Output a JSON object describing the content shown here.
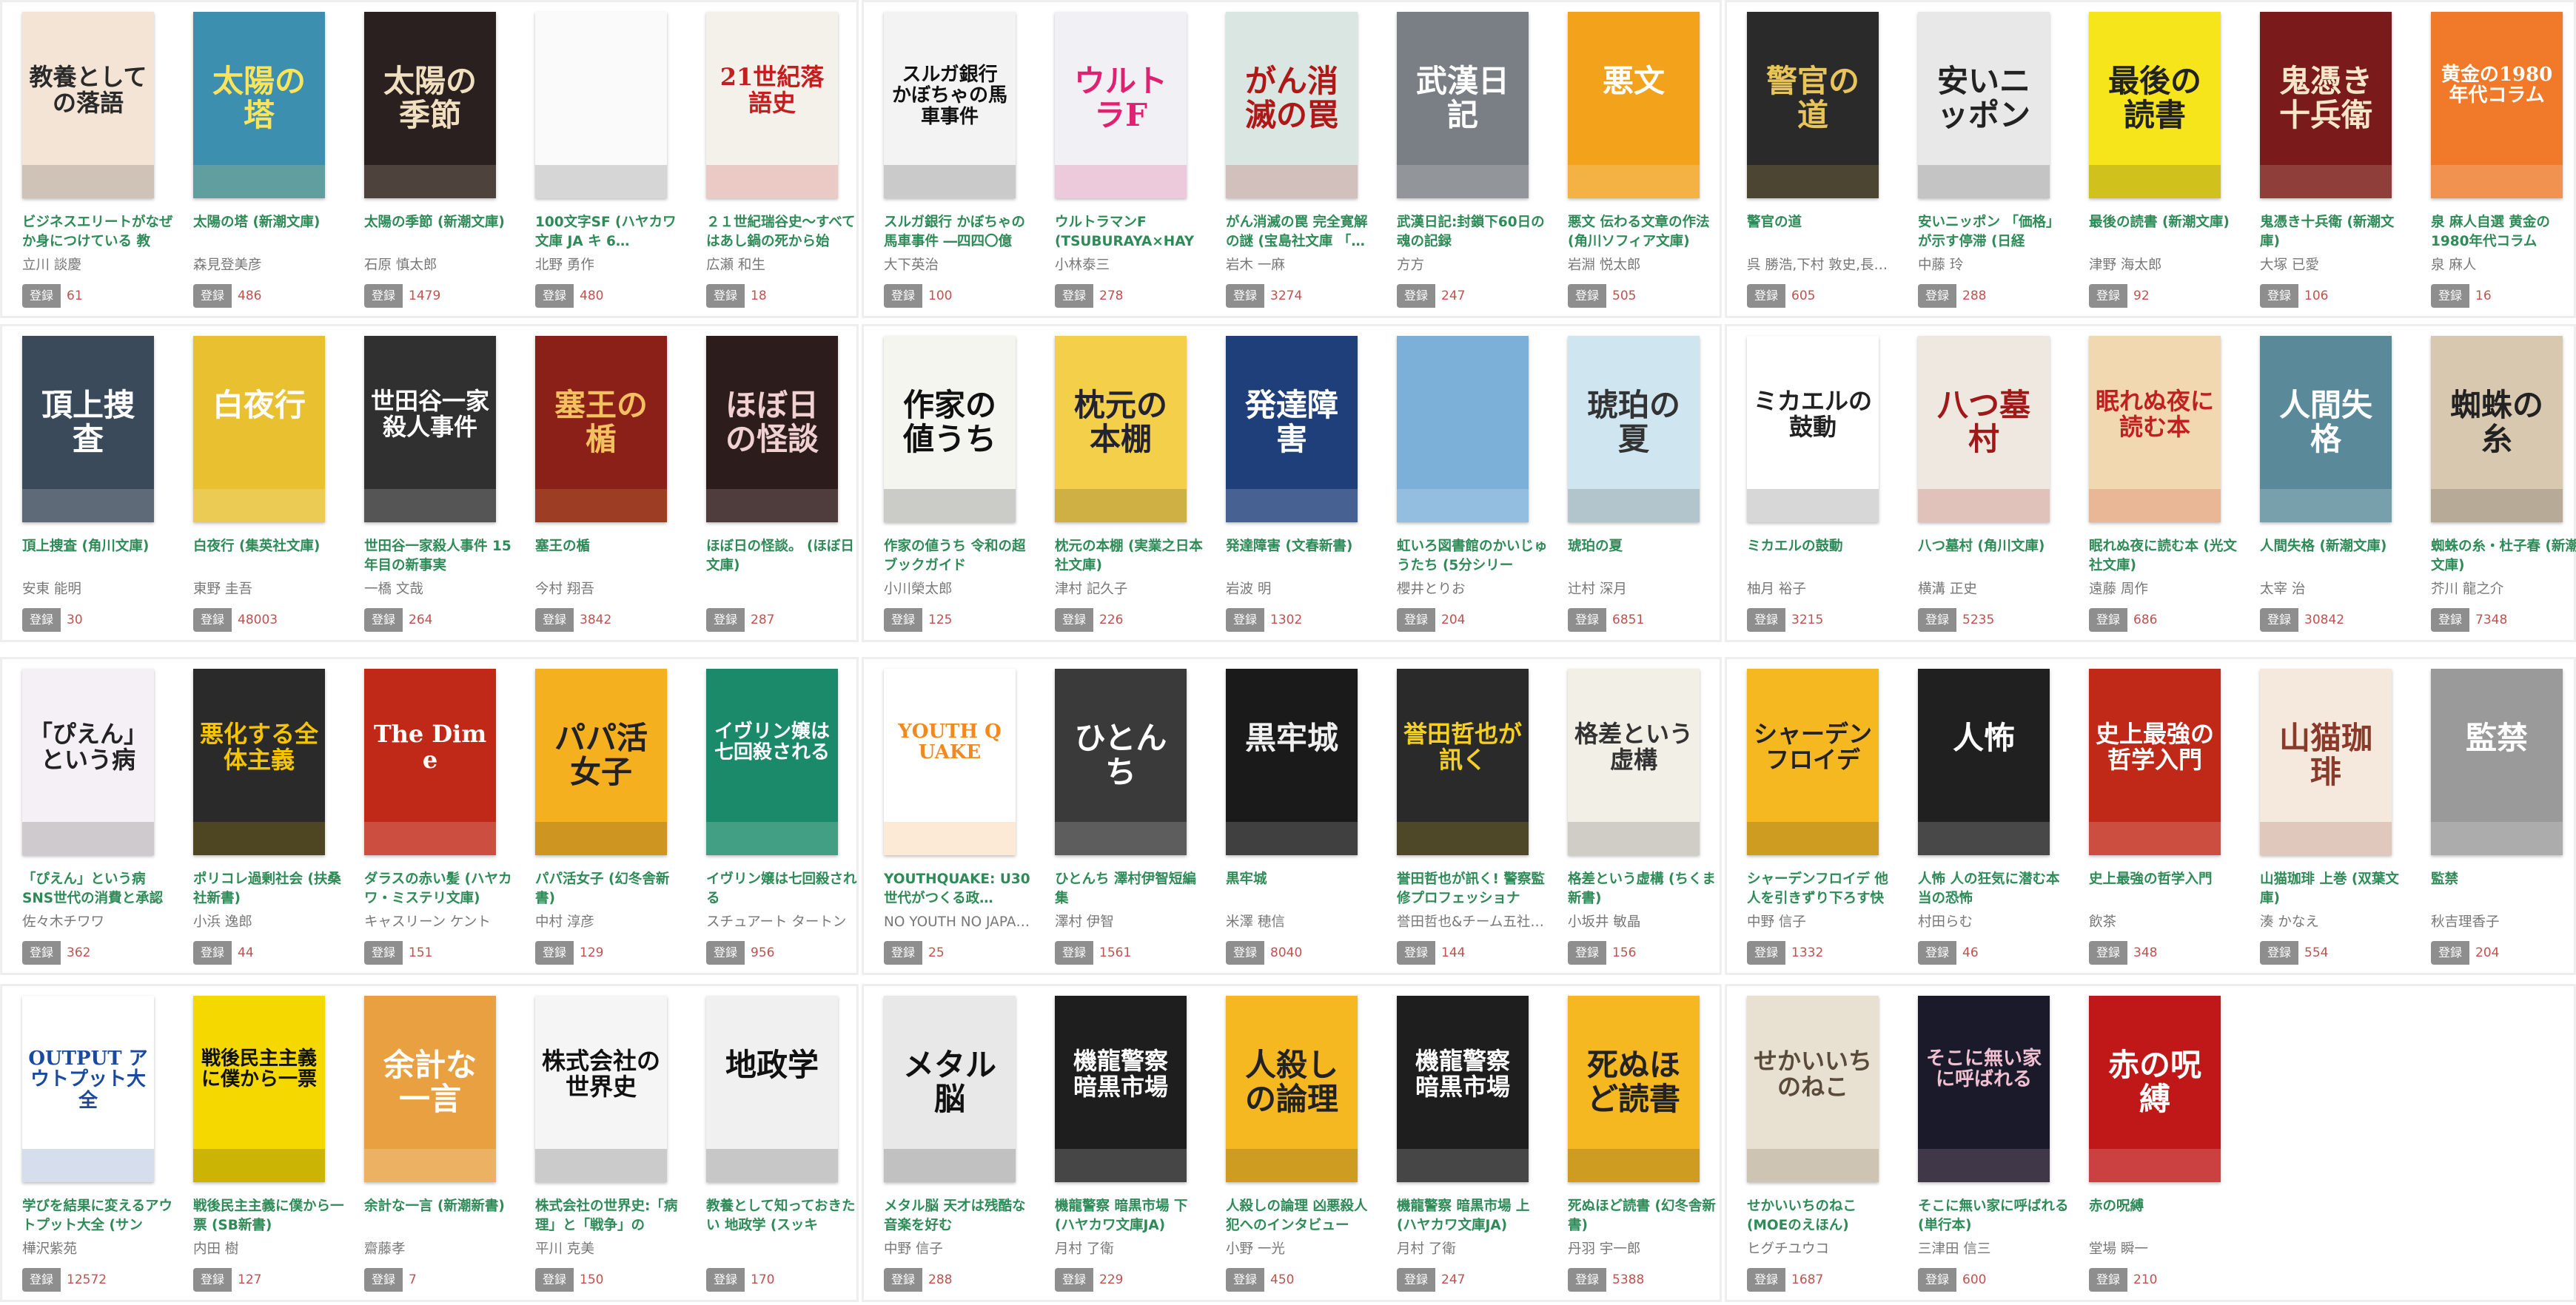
{
  "register_label": "登録",
  "books": [
    {
      "title": "ビジネスエリートがなぜか身につけている 教",
      "author": "立川 談慶",
      "count": "61",
      "cover_text": "教養としての落語",
      "bg": "#f3e4d6",
      "fg": "#2a2a2a"
    },
    {
      "title": "太陽の塔 (新潮文庫)",
      "author": "森見登美彦",
      "count": "486",
      "cover_text": "太陽の塔",
      "bg": "#3d8fb0",
      "fg": "#ffe45a"
    },
    {
      "title": "太陽の季節 (新潮文庫)",
      "author": "石原 慎太郎",
      "count": "1479",
      "cover_text": "太陽の季節",
      "bg": "#2b2020",
      "fg": "#f0e0c0"
    },
    {
      "title": "100文字SF (ハヤカワ文庫 JA キ 6…",
      "author": "北野 勇作",
      "count": "480",
      "cover_text": "",
      "bg": "#fafafa",
      "fg": "#333"
    },
    {
      "title": "２１世紀瑞谷史～すべてはあし鍋の死から始",
      "author": "広瀬 和生",
      "count": "18",
      "cover_text": "21世紀落語史",
      "bg": "#f4f0ea",
      "fg": "#c41e1e"
    },
    {
      "title": "スルガ銀行 かぼちゃの馬車事件 ―四四〇億",
      "author": "大下英治",
      "count": "100",
      "cover_text": "スルガ銀行 かぼちゃの馬車事件",
      "bg": "#f3f3f3",
      "fg": "#111"
    },
    {
      "title": "ウルトラマンF (TSUBURAYA×HAY",
      "author": "小林泰三",
      "count": "278",
      "cover_text": "ウルトラF",
      "bg": "#f0f0f5",
      "fg": "#e02070"
    },
    {
      "title": "がん消滅の罠 完全寛解の謎 (宝島社文庫 「…",
      "author": "岩木 一麻",
      "count": "3274",
      "cover_text": "がん消滅の罠",
      "bg": "#d9e6e1",
      "fg": "#b01818"
    },
    {
      "title": "武漢日記:封鎖下60日の魂の記録",
      "author": "方方",
      "count": "247",
      "cover_text": "武漢日記",
      "bg": "#7a7f86",
      "fg": "#ffffff"
    },
    {
      "title": "悪文 伝わる文章の作法 (角川ソフィア文庫)",
      "author": "岩淵 悦太郎",
      "count": "505",
      "cover_text": "悪文",
      "bg": "#f2a21b",
      "fg": "#ffffff"
    },
    {
      "title": "警官の道",
      "author": "呉 勝浩,下村 敦史,長…",
      "count": "605",
      "cover_text": "警官の道",
      "bg": "#2a2a2a",
      "fg": "#e8c45a"
    },
    {
      "title": "安いニッポン 「価格」が示す停滞 (日経",
      "author": "中藤 玲",
      "count": "288",
      "cover_text": "安いニッポン",
      "bg": "#e8e8e8",
      "fg": "#222"
    },
    {
      "title": "最後の読書 (新潮文庫)",
      "author": "津野 海太郎",
      "count": "92",
      "cover_text": "最後の読書",
      "bg": "#f7e51c",
      "fg": "#222"
    },
    {
      "title": "鬼憑き十兵衛 (新潮文庫)",
      "author": "大塚 已愛",
      "count": "106",
      "cover_text": "鬼憑き十兵衛",
      "bg": "#7a1a1a",
      "fg": "#f5e6c8"
    },
    {
      "title": "泉 麻人自選 黄金の1980年代コラム",
      "author": "泉 麻人",
      "count": "16",
      "cover_text": "黄金の1980年代コラム",
      "bg": "#f07a2a",
      "fg": "#ffffff"
    },
    {
      "title": "頂上捜査 (角川文庫)",
      "author": "安東 能明",
      "count": "30",
      "cover_text": "頂上捜査",
      "bg": "#3b4a5a",
      "fg": "#ffffff"
    },
    {
      "title": "白夜行 (集英社文庫)",
      "author": "東野 圭吾",
      "count": "48003",
      "cover_text": "白夜行",
      "bg": "#e8c030",
      "fg": "#ffffff"
    },
    {
      "title": "世田谷一家殺人事件 15年目の新事実",
      "author": "一橋 文哉",
      "count": "264",
      "cover_text": "世田谷一家殺人事件",
      "bg": "#303030",
      "fg": "#ffffff"
    },
    {
      "title": "塞王の楯",
      "author": "今村 翔吾",
      "count": "3842",
      "cover_text": "塞王の楯",
      "bg": "#8a2018",
      "fg": "#f2c060"
    },
    {
      "title": "ほぼ日の怪談。 (ほぼ日文庫)",
      "author": "",
      "count": "287",
      "cover_text": "ほぼ日の怪談",
      "bg": "#2c1c1c",
      "fg": "#f0d0d0"
    },
    {
      "title": "作家の値うち 令和の超ブックガイド",
      "author": "小川榮太郎",
      "count": "125",
      "cover_text": "作家の値うち",
      "bg": "#f5f5f0",
      "fg": "#111"
    },
    {
      "title": "枕元の本棚 (実業之日本社文庫)",
      "author": "津村 記久子",
      "count": "226",
      "cover_text": "枕元の本棚",
      "bg": "#f4d04a",
      "fg": "#223"
    },
    {
      "title": "発達障害 (文春新書)",
      "author": "岩波 明",
      "count": "1302",
      "cover_text": "発達障害",
      "bg": "#1e3f7a",
      "fg": "#ffffff"
    },
    {
      "title": "虹いろ図書館のかいじゅうたち (5分シリー",
      "author": "櫻井とりお",
      "count": "204",
      "cover_text": "",
      "bg": "#7cb0d8",
      "fg": "#fff"
    },
    {
      "title": "琥珀の夏",
      "author": "辻村 深月",
      "count": "6851",
      "cover_text": "琥珀の夏",
      "bg": "#cfe6f0",
      "fg": "#333"
    },
    {
      "title": "ミカエルの鼓動",
      "author": "柚月 裕子",
      "count": "3215",
      "cover_text": "ミカエルの鼓動",
      "bg": "#ffffff",
      "fg": "#222"
    },
    {
      "title": "八つ墓村 (角川文庫)",
      "author": "横溝 正史",
      "count": "5235",
      "cover_text": "八つ墓村",
      "bg": "#efe8e0",
      "fg": "#a01818"
    },
    {
      "title": "眠れぬ夜に読む本 (光文社文庫)",
      "author": "遠藤 周作",
      "count": "686",
      "cover_text": "眠れぬ夜に読む本",
      "bg": "#f2d8b0",
      "fg": "#c02020"
    },
    {
      "title": "人間失格 (新潮文庫)",
      "author": "太宰 治",
      "count": "30842",
      "cover_text": "人間失格",
      "bg": "#5a8a9a",
      "fg": "#ffffff"
    },
    {
      "title": "蜘蛛の糸・杜子春 (新潮文庫)",
      "author": "芥川 龍之介",
      "count": "7348",
      "cover_text": "蜘蛛の糸",
      "bg": "#d8c8b0",
      "fg": "#222"
    },
    {
      "title": "「ぴえん」という病 SNS世代の消費と承認",
      "author": "佐々木チワワ",
      "count": "362",
      "cover_text": "「ぴえん」という病",
      "bg": "#f5f0f5",
      "fg": "#222"
    },
    {
      "title": "ポリコレ過剰社会 (扶桑社新書)",
      "author": "小浜 逸郎",
      "count": "44",
      "cover_text": "悪化する全体主義",
      "bg": "#2a2a2a",
      "fg": "#f5c400"
    },
    {
      "title": "ダラスの赤い髪 (ハヤカワ・ミステリ文庫)",
      "author": "キャスリーン ケント",
      "count": "151",
      "cover_text": "The Dime",
      "bg": "#c02818",
      "fg": "#ffffff"
    },
    {
      "title": "パパ活女子 (幻冬舎新書)",
      "author": "中村 淳彦",
      "count": "129",
      "cover_text": "パパ活女子",
      "bg": "#f5b020",
      "fg": "#222"
    },
    {
      "title": "イヴリン嬢は七回殺される",
      "author": "スチュアート タートン",
      "count": "956",
      "cover_text": "イヴリン嬢は七回殺される",
      "bg": "#1a8a6a",
      "fg": "#ffffff"
    },
    {
      "title": "YOUTHQUAKE: U30世代がつくる政…",
      "author": "NO YOUTH NO JAPA…",
      "count": "25",
      "cover_text": "YOUTH QUAKE",
      "bg": "#ffffff",
      "fg": "#f08a20"
    },
    {
      "title": "ひとんち 澤村伊智短編集",
      "author": "澤村 伊智",
      "count": "1561",
      "cover_text": "ひとんち",
      "bg": "#3a3a3a",
      "fg": "#ffffff"
    },
    {
      "title": "黒牢城",
      "author": "米澤 穂信",
      "count": "8040",
      "cover_text": "黒牢城",
      "bg": "#1a1a1a",
      "fg": "#f0f0f0"
    },
    {
      "title": "誉田哲也が訊く! 警察監修プロフェッショナ",
      "author": "誉田哲也&チーム五社…",
      "count": "144",
      "cover_text": "誉田哲也が訊く",
      "bg": "#2a2a2a",
      "fg": "#f5d020"
    },
    {
      "title": "格差という虚構 (ちくま新書)",
      "author": "小坂井 敏晶",
      "count": "156",
      "cover_text": "格差という虚構",
      "bg": "#f2efe6",
      "fg": "#333"
    },
    {
      "title": "シャーデンフロイデ 他人を引きずり下ろす快",
      "author": "中野 信子",
      "count": "1332",
      "cover_text": "シャーデンフロイデ",
      "bg": "#f5b820",
      "fg": "#222"
    },
    {
      "title": "人怖 人の狂気に潜む本当の恐怖",
      "author": "村田らむ",
      "count": "46",
      "cover_text": "人怖",
      "bg": "#202020",
      "fg": "#ffffff"
    },
    {
      "title": "史上最強の哲学入門",
      "author": "飲茶",
      "count": "348",
      "cover_text": "史上最強の哲学入門",
      "bg": "#c02818",
      "fg": "#ffffff"
    },
    {
      "title": "山猫珈琲 上巻 (双葉文庫)",
      "author": "湊 かなえ",
      "count": "554",
      "cover_text": "山猫珈琲",
      "bg": "#f5e8dc",
      "fg": "#8a3a2a"
    },
    {
      "title": "監禁",
      "author": "秋吉理香子",
      "count": "204",
      "cover_text": "監禁",
      "bg": "#9a9a9a",
      "fg": "#ffffff"
    },
    {
      "title": "学びを結果に変えるアウトプット大全 (サン",
      "author": "樺沢紫苑",
      "count": "12572",
      "cover_text": "OUTPUT アウトプット大全",
      "bg": "#ffffff",
      "fg": "#1a4aa0"
    },
    {
      "title": "戦後民主主義に僕から一票 (SB新書)",
      "author": "内田 樹",
      "count": "127",
      "cover_text": "戦後民主主義に僕から一票",
      "bg": "#f5d800",
      "fg": "#111"
    },
    {
      "title": "余計な一言 (新潮新書)",
      "author": "齋藤孝",
      "count": "7",
      "cover_text": "余計な一言",
      "bg": "#e8a040",
      "fg": "#ffffff"
    },
    {
      "title": "株式会社の世界史:「病理」と「戦争」の",
      "author": "平川 克美",
      "count": "150",
      "cover_text": "株式会社の世界史",
      "bg": "#f5f5f5",
      "fg": "#111"
    },
    {
      "title": "教養として知っておきたい 地政学 (スッキ",
      "author": "",
      "count": "170",
      "cover_text": "地政学",
      "bg": "#f0f0f0",
      "fg": "#111"
    },
    {
      "title": "メタル脳 天才は残酷な音楽を好む",
      "author": "中野 信子",
      "count": "288",
      "cover_text": "メタル脳",
      "bg": "#e8e8e8",
      "fg": "#111"
    },
    {
      "title": "機龍警察 暗黒市場 下 (ハヤカワ文庫JA)",
      "author": "月村 了衛",
      "count": "229",
      "cover_text": "機龍警察 暗黒市場",
      "bg": "#1e1e1e",
      "fg": "#ffffff"
    },
    {
      "title": "人殺しの論理 凶悪殺人犯へのインタビュー",
      "author": "小野 一光",
      "count": "450",
      "cover_text": "人殺しの論理",
      "bg": "#f5b820",
      "fg": "#222"
    },
    {
      "title": "機龍警察 暗黒市場 上 (ハヤカワ文庫JA)",
      "author": "月村 了衛",
      "count": "247",
      "cover_text": "機龍警察 暗黒市場",
      "bg": "#1e1e1e",
      "fg": "#ffffff"
    },
    {
      "title": "死ぬほど読書 (幻冬舎新書)",
      "author": "丹羽 宇一郎",
      "count": "5388",
      "cover_text": "死ぬほど読書",
      "bg": "#f5b820",
      "fg": "#222"
    },
    {
      "title": "せかいいちのねこ (MOEのえほん)",
      "author": "ヒグチユウコ",
      "count": "1687",
      "cover_text": "せかいいちのねこ",
      "bg": "#e8e0d0",
      "fg": "#5a4a3a"
    },
    {
      "title": "そこに無い家に呼ばれる (単行本)",
      "author": "三津田 信三",
      "count": "600",
      "cover_text": "そこに無い家に呼ばれる",
      "bg": "#1a1a2a",
      "fg": "#f0c0d0"
    },
    {
      "title": "赤の呪縛",
      "author": "堂場 瞬一",
      "count": "210",
      "cover_text": "赤の呪縛",
      "bg": "#c01818",
      "fg": "#ffffff"
    }
  ]
}
